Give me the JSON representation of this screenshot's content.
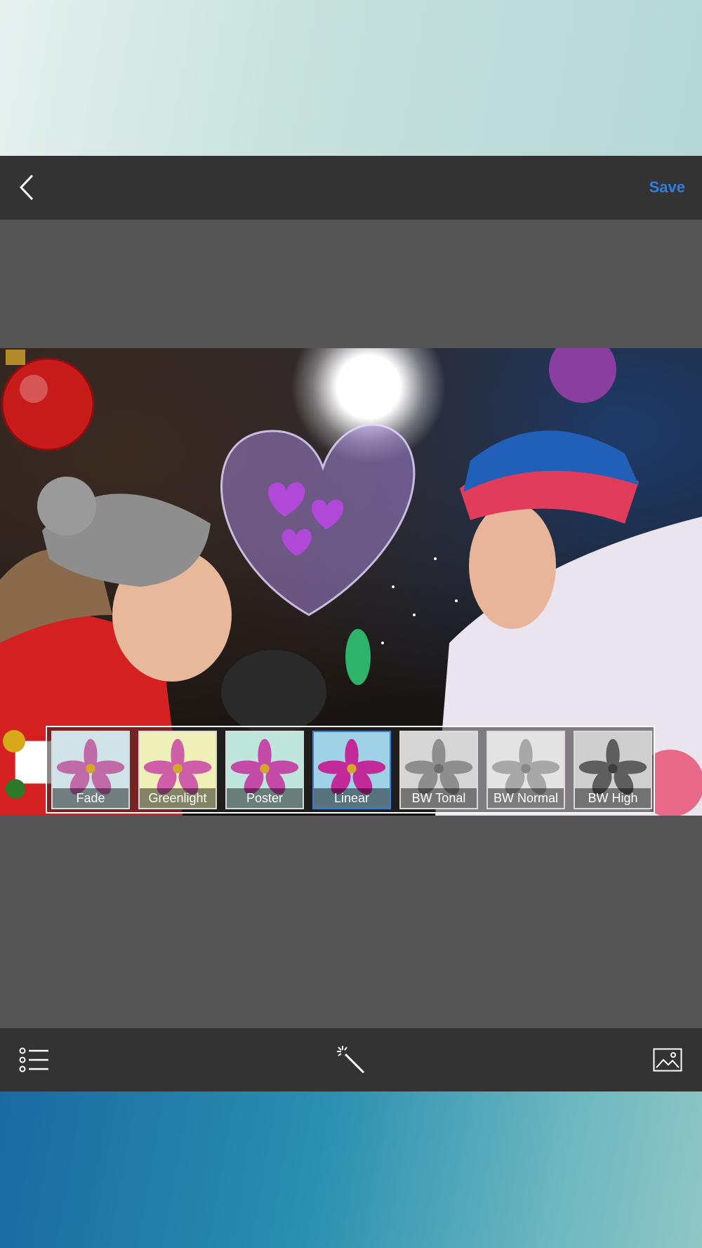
{
  "header": {
    "save_label": "Save"
  },
  "icons": {
    "back": "chevron-left-icon",
    "list": "list-icon",
    "magic": "magic-wand-icon",
    "gallery": "image-icon"
  },
  "filters": [
    {
      "label": "Fade",
      "selected": false
    },
    {
      "label": "Greenlight",
      "selected": false
    },
    {
      "label": "Poster",
      "selected": false
    },
    {
      "label": "Linear",
      "selected": true
    },
    {
      "label": "BW Tonal",
      "selected": false
    },
    {
      "label": "BW Normal",
      "selected": false
    },
    {
      "label": "BW High",
      "selected": false
    }
  ],
  "colors": {
    "accent": "#2f7ee0",
    "bar": "#333333",
    "canvas": "#555555"
  }
}
